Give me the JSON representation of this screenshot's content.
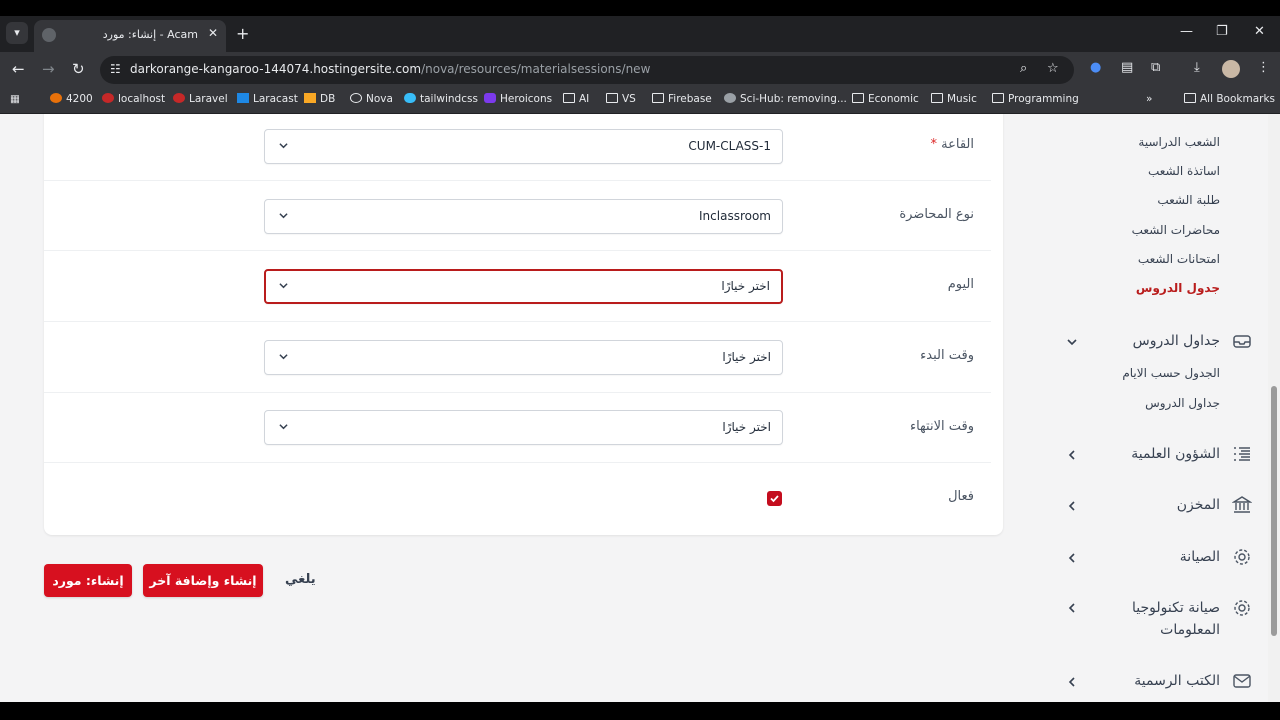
{
  "browser": {
    "tab_title": "إنشاء: مورد - Acam",
    "url_host": "darkorange-kangaroo-144074.hostingersite.com",
    "url_path": "/nova/resources/materialsessions/new",
    "bookmarks": [
      "4200",
      "localhost",
      "Laravel",
      "Laracast",
      "DB",
      "Nova",
      "tailwindcss",
      "Heroicons",
      "AI",
      "VS",
      "Firebase",
      "Sci-Hub: removing...",
      "Economic",
      "Music",
      "Programming"
    ],
    "all_bookmarks": "All Bookmarks"
  },
  "form": {
    "fields": [
      {
        "label": "القاعة",
        "required_mark": "*",
        "value": "CUM-CLASS-1"
      },
      {
        "label": "نوع المحاضرة",
        "value": "Inclassroom"
      },
      {
        "label": "اليوم",
        "value": "اختر خيارًا"
      },
      {
        "label": "وقت البدء",
        "value": "اختر خيارًا"
      },
      {
        "label": "وقت الانتهاء",
        "value": "اختر خيارًا"
      }
    ],
    "active_label": "فعال",
    "active_checked": true
  },
  "actions": {
    "create": "إنشاء: مورد",
    "create_another": "إنشاء وإضافة آخر",
    "cancel": "يلغي"
  },
  "sidebar": {
    "sub_items": [
      "الشعب الدراسية",
      "اساتذة الشعب",
      "طلبة الشعب",
      "محاضرات الشعب",
      "امتحانات الشعب",
      "جدول الدروس"
    ],
    "schedules": {
      "title": "جداول الدروس",
      "items": [
        "الجدول حسب الايام",
        "جداول الدروس"
      ]
    },
    "sections": [
      "الشؤون العلمية",
      "المخزن",
      "الصيانة",
      "صيانة تكنولوجيا المعلومات",
      "الكتب الرسمية"
    ]
  },
  "colors": {
    "accent": "#d7101f",
    "active_text": "#b91c1c"
  }
}
